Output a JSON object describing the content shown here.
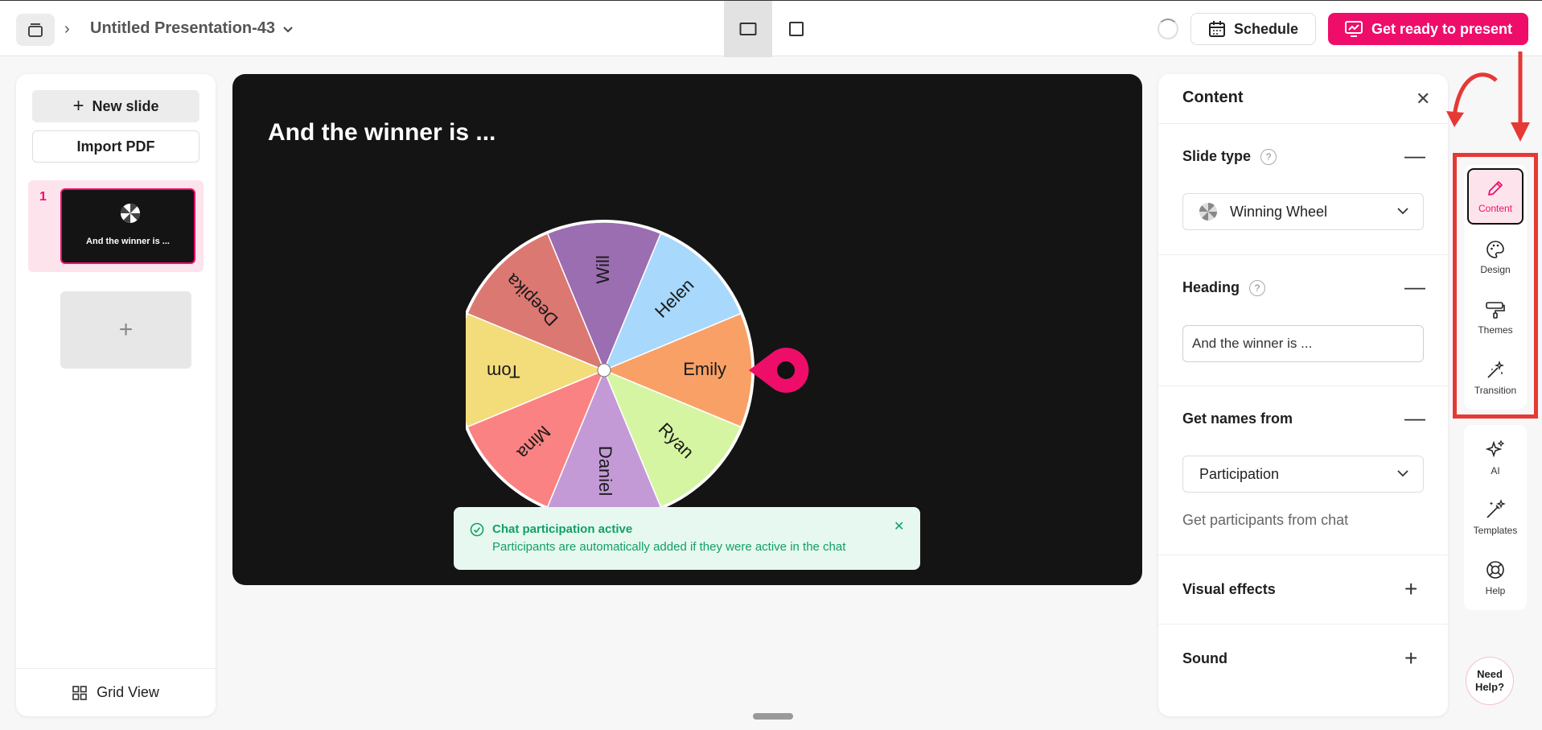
{
  "header": {
    "doc_title": "Untitled Presentation-43",
    "schedule_label": "Schedule",
    "present_label": "Get ready to present"
  },
  "left_panel": {
    "new_slide_label": "New slide",
    "import_pdf_label": "Import PDF",
    "slides": [
      {
        "number": "1",
        "title": "And the winner is ..."
      }
    ],
    "grid_view_label": "Grid View"
  },
  "stage": {
    "title": "And the winner is ...",
    "wheel": {
      "segments": [
        {
          "name": "Will",
          "color": "#9b6db1"
        },
        {
          "name": "Helen",
          "color": "#a8d8fb"
        },
        {
          "name": "Emily",
          "color": "#f9a066"
        },
        {
          "name": "Ryan",
          "color": "#d6f5a3"
        },
        {
          "name": "Daniel",
          "color": "#c39ad6"
        },
        {
          "name": "Mina",
          "color": "#fb8282"
        },
        {
          "name": "Tom",
          "color": "#f3dc7a"
        },
        {
          "name": "Deepika",
          "color": "#dc7872"
        }
      ]
    },
    "toast": {
      "title": "Chat participation active",
      "body": "Participants are automatically added if they were active in the chat"
    }
  },
  "content_panel": {
    "title": "Content",
    "slide_type": {
      "label": "Slide type",
      "value": "Winning Wheel"
    },
    "heading": {
      "label": "Heading",
      "value": "And the winner is ..."
    },
    "names_from": {
      "label": "Get names from",
      "value": "Participation",
      "hint": "Get participants from chat"
    },
    "visual_effects_label": "Visual effects",
    "sound_label": "Sound"
  },
  "rail": {
    "items": [
      {
        "label": "Content",
        "icon": "pencil-icon"
      },
      {
        "label": "Design",
        "icon": "palette-icon"
      },
      {
        "label": "Themes",
        "icon": "paint-roller-icon"
      },
      {
        "label": "Transition",
        "icon": "magic-wand-icon"
      }
    ],
    "items2": [
      {
        "label": "AI",
        "icon": "sparkle-icon"
      },
      {
        "label": "Templates",
        "icon": "wand-sparkle-icon"
      },
      {
        "label": "Help",
        "icon": "lifebuoy-icon"
      }
    ],
    "need_help_line1": "Need",
    "need_help_line2": "Help?"
  },
  "colors": {
    "accent": "#ef0d6a",
    "annotation_red": "#e53935",
    "toast_green": "#12a065"
  }
}
